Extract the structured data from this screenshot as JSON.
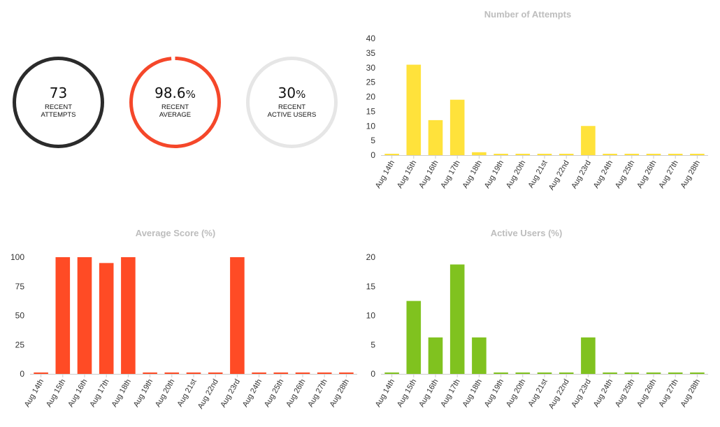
{
  "stats": [
    {
      "value": "73",
      "unit": "",
      "label": "RECENT ATTEMPTS",
      "color": "#2b2b2b",
      "progress": 1.0
    },
    {
      "value": "98.6",
      "unit": "%",
      "label": "RECENT AVERAGE",
      "color": "#f5472a",
      "progress": 0.986
    },
    {
      "value": "30",
      "unit": "%",
      "label": "RECENT ACTIVE USERS",
      "color": "#e6e6e6",
      "progress": 1.0
    }
  ],
  "chart_data": [
    {
      "id": "attempts",
      "type": "bar",
      "title": "Number of Attempts",
      "color": "#ffe23b",
      "categories": [
        "Aug 14th",
        "Aug 15th",
        "Aug 16th",
        "Aug 17th",
        "Aug 18th",
        "Aug 19th",
        "Aug 20th",
        "Aug 21st",
        "Aug 22nd",
        "Aug 23rd",
        "Aug 24th",
        "Aug 25th",
        "Aug 26th",
        "Aug 27th",
        "Aug 28th"
      ],
      "values": [
        0,
        31,
        12,
        19,
        1,
        0,
        0,
        0,
        0,
        10,
        0,
        0,
        0,
        0,
        0
      ],
      "ylim": [
        0,
        40
      ],
      "yticks": [
        "0",
        "5",
        "10",
        "15",
        "20",
        "25",
        "30",
        "35",
        "40"
      ],
      "grid": false,
      "xlabel": "",
      "ylabel": ""
    },
    {
      "id": "average",
      "type": "bar",
      "title": "Average Score (%)",
      "color": "#ff4b25",
      "categories": [
        "Aug 14th",
        "Aug 15th",
        "Aug 16th",
        "Aug 17th",
        "Aug 18th",
        "Aug 19th",
        "Aug 20th",
        "Aug 21st",
        "Aug 22nd",
        "Aug 23rd",
        "Aug 24th",
        "Aug 25th",
        "Aug 26th",
        "Aug 27th",
        "Aug 28th"
      ],
      "values": [
        0,
        100,
        100,
        95,
        100,
        0,
        0,
        0,
        0,
        100,
        0,
        0,
        0,
        0,
        0
      ],
      "ylim": [
        0,
        100
      ],
      "yticks": [
        "0",
        "25",
        "50",
        "75",
        "100"
      ],
      "grid": false,
      "xlabel": "",
      "ylabel": ""
    },
    {
      "id": "active",
      "type": "bar",
      "title": "Active Users (%)",
      "color": "#80c21f",
      "categories": [
        "Aug 14th",
        "Aug 15th",
        "Aug 16th",
        "Aug 17th",
        "Aug 18th",
        "Aug 19th",
        "Aug 20th",
        "Aug 21st",
        "Aug 22nd",
        "Aug 23rd",
        "Aug 24th",
        "Aug 25th",
        "Aug 26th",
        "Aug 27th",
        "Aug 28th"
      ],
      "values": [
        0,
        12.5,
        6.25,
        18.75,
        6.25,
        0,
        0,
        0,
        0,
        6.25,
        0,
        0,
        0,
        0,
        0
      ],
      "ylim": [
        0,
        20
      ],
      "yticks": [
        "0",
        "5",
        "10",
        "15",
        "20"
      ],
      "grid": false,
      "xlabel": "",
      "ylabel": ""
    }
  ]
}
